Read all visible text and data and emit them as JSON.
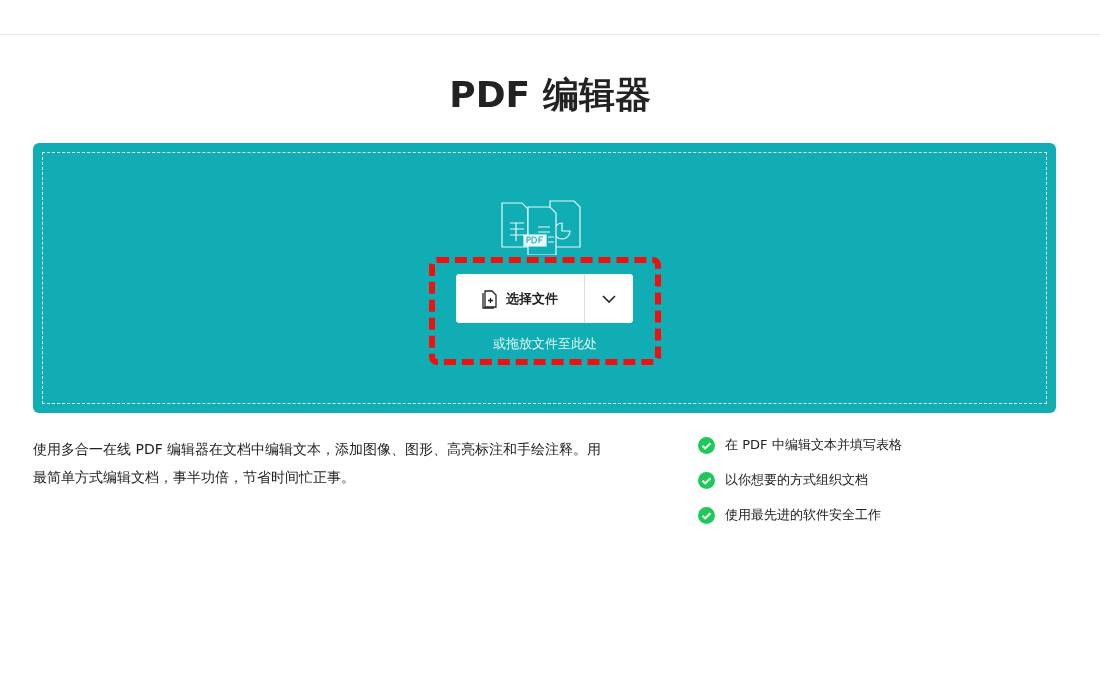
{
  "title": "PDF 编辑器",
  "upload": {
    "button": "选择文件",
    "drop_hint": "或拖放文件至此处"
  },
  "description": "使用多合一在线 PDF 编辑器在文档中编辑文本，添加图像、图形、高亮标注和手绘注释。用最简单方式编辑文档，事半功倍，节省时间忙正事。",
  "features": [
    "在 PDF 中编辑文本并填写表格",
    "以你想要的方式组织文档",
    "使用最先进的软件安全工作"
  ]
}
